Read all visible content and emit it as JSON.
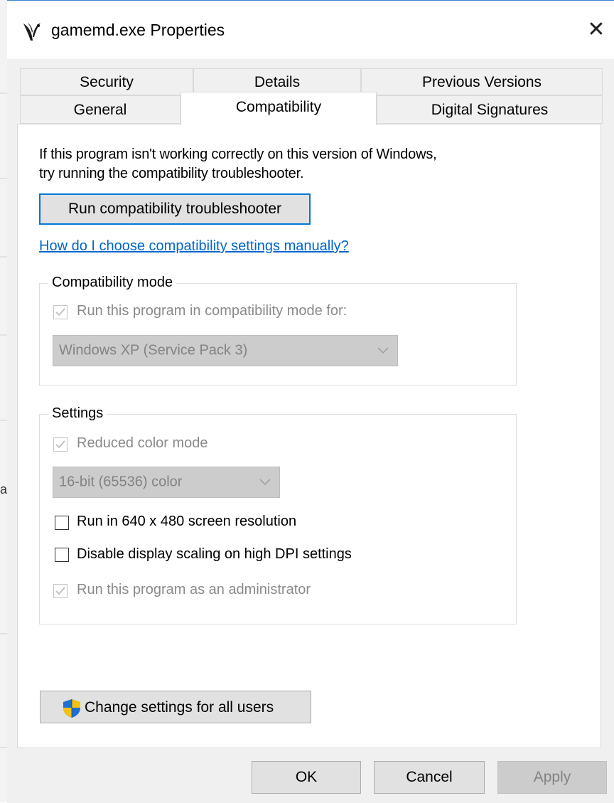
{
  "window": {
    "title": "gamemd.exe Properties",
    "close_glyph": "✕",
    "background_edge_letter": "a"
  },
  "tabs": {
    "row_back": [
      "Security",
      "Details",
      "Previous Versions"
    ],
    "row_front": [
      "General",
      "Compatibility",
      "Digital Signatures"
    ],
    "active": "Compatibility"
  },
  "content": {
    "intro_line1": "If this program isn't working correctly on this version of Windows,",
    "intro_line2": "try running the compatibility troubleshooter.",
    "troubleshooter_button": "Run compatibility troubleshooter",
    "manual_link": "How do I choose compatibility settings manually?"
  },
  "compat_mode": {
    "legend": "Compatibility mode",
    "checkbox_label": "Run this program in compatibility mode for:",
    "checked": true,
    "enabled": false,
    "selected_os": "Windows XP (Service Pack 3)"
  },
  "settings": {
    "legend": "Settings",
    "reduced_color": {
      "label": "Reduced color mode",
      "checked": true,
      "enabled": false
    },
    "color_depth": "16-bit (65536) color",
    "resolution": {
      "label": "Run in 640 x 480 screen resolution",
      "checked": false,
      "enabled": true
    },
    "dpi": {
      "label": "Disable display scaling on high DPI settings",
      "checked": false,
      "enabled": true
    },
    "admin": {
      "label": "Run this program as an administrator",
      "checked": true,
      "enabled": false
    }
  },
  "change_all_users_button": "Change settings for all users",
  "footer": {
    "ok": "OK",
    "cancel": "Cancel",
    "apply": "Apply"
  },
  "icons": {
    "app": "gamemd-app-icon",
    "shield": "uac-shield-icon",
    "close": "close-icon",
    "chevron": "chevron-down-icon",
    "check": "checkmark-icon"
  },
  "colors": {
    "link": "#0066cc",
    "focus_border": "#0078d7",
    "dialog_bg": "#f0f0f0",
    "disabled_text": "#838383"
  }
}
